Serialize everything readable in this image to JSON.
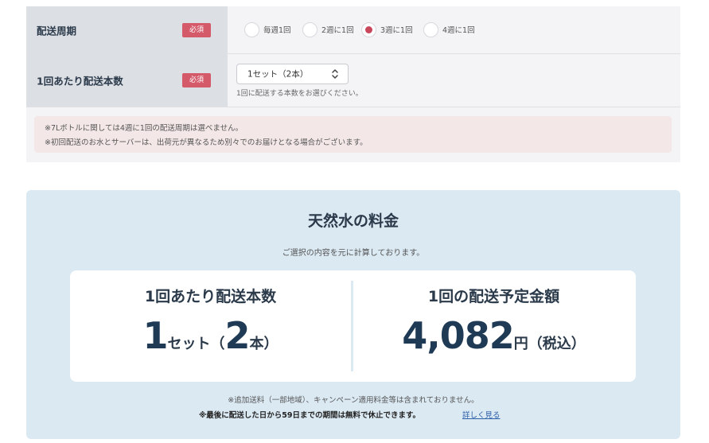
{
  "form": {
    "delivery_cycle": {
      "label": "配送周期",
      "required_badge": "必須",
      "options": [
        {
          "label": "毎週1回",
          "checked": false
        },
        {
          "label": "2週に1回",
          "checked": false
        },
        {
          "label": "3週に1回",
          "checked": true
        },
        {
          "label": "4週に1回",
          "checked": false
        }
      ]
    },
    "bottles_per_delivery": {
      "label": "1回あたり配送本数",
      "required_badge": "必須",
      "select_value": "1セット（2本）",
      "help_text": "1回に配送する本数をお選びください。"
    },
    "notices": [
      "※7Lボトルに関しては4週に1回の配送周期は選べません。",
      "※初回配送のお水とサーバーは、出荷元が異なるため別々でのお届けとなる場合がございます。"
    ]
  },
  "pricing": {
    "title": "天然水の料金",
    "subtitle": "ご選択の内容を元に計算しております。",
    "left": {
      "heading": "1回あたり配送本数",
      "sets": "1",
      "sets_unit": "セット",
      "paren_open": "（",
      "bottles": "2",
      "bottles_unit": "本",
      "paren_close": "）"
    },
    "right": {
      "heading": "1回の配送予定金額",
      "amount": "4,082",
      "currency": "円",
      "tax_note": "（税込）"
    },
    "footnote_1": "※追加送料（一部地域）、キャンペーン適用料金等は含まれておりません。",
    "footnote_2": "※最後に配送した日から59日までの期間は無料で休止できます。",
    "details_link": "詳しく見る"
  },
  "colors": {
    "accent_red": "#c9475b",
    "required_badge": "#d45a6a",
    "pricing_bg": "#dbe9f3",
    "price_text": "#1e3a55",
    "link": "#2b5fa8"
  }
}
